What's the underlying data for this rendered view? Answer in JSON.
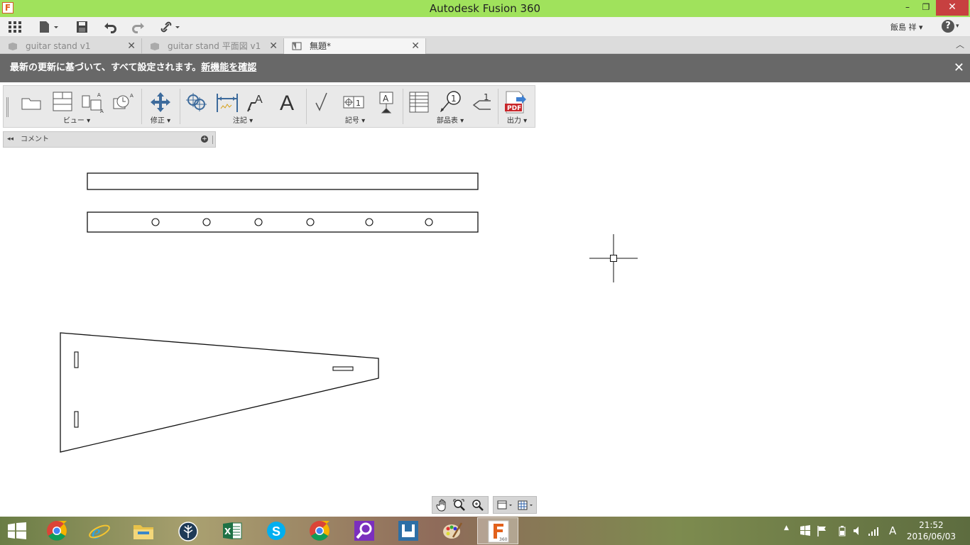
{
  "window": {
    "title": "Autodesk Fusion 360",
    "logo_letter": "F",
    "minimize": "–",
    "restore": "❐",
    "close": "✕"
  },
  "toolbar": {
    "user_name": "飯島 祥 ▾",
    "help": "?"
  },
  "tabs": [
    {
      "label": "guitar stand v1",
      "active": false
    },
    {
      "label": "guitar stand 平面図 v1",
      "active": false
    },
    {
      "label": "無題*",
      "active": true
    }
  ],
  "banner": {
    "text": "最新の更新に基づいて、すべて設定されます。",
    "link": "新機能を確認",
    "close": "✕"
  },
  "ribbon": {
    "groups": [
      {
        "label": "ビュー ▾"
      },
      {
        "label": "修正 ▾"
      },
      {
        "label": "注記 ▾"
      },
      {
        "label": "記号 ▾"
      },
      {
        "label": "部品表 ▾"
      },
      {
        "label": "出力 ▾"
      }
    ],
    "pdf_text": "PDF",
    "balloon_number": "1"
  },
  "comment_panel": {
    "label": "コメント"
  },
  "colors": {
    "titlebar": "#a0e25c",
    "banner": "#686868",
    "ribbon": "#e9e9e9",
    "accent": "#e2611c"
  },
  "taskbar": {
    "apps": [
      "windows-start",
      "chrome",
      "internet-explorer",
      "file-explorer",
      "app-sprout",
      "excel",
      "skype",
      "chrome",
      "search-app",
      "fusion-slicer",
      "paint",
      "fusion-360"
    ],
    "tray_ime": "A",
    "time": "21:52",
    "date": "2016/06/03"
  }
}
